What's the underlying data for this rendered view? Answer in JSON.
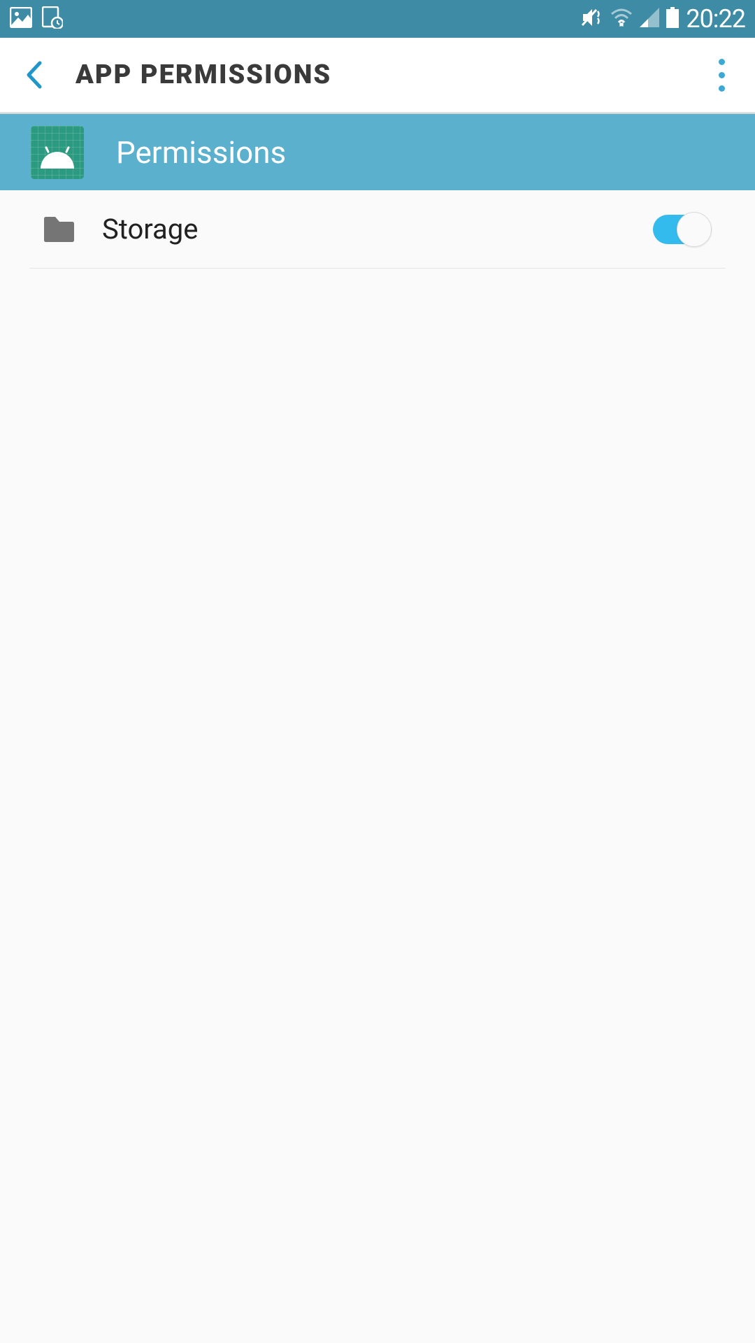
{
  "statusbar": {
    "time": "20:22"
  },
  "appbar": {
    "title": "APP PERMISSIONS"
  },
  "header": {
    "title": "Permissions"
  },
  "permissions": {
    "storage": {
      "label": "Storage",
      "enabled": true
    }
  }
}
